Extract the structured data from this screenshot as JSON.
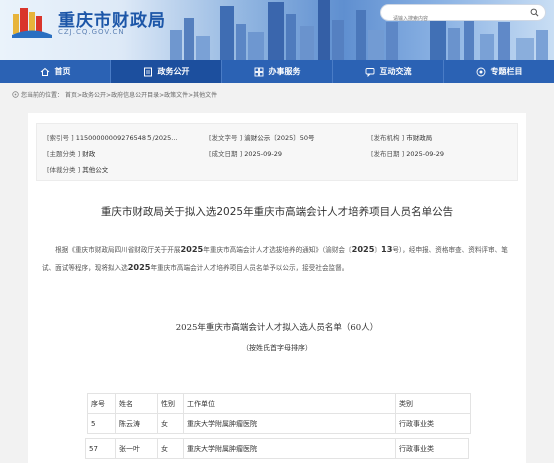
{
  "header": {
    "site_title": "重庆市财政局",
    "site_domain": "CZJ.CQ.GOV.CN",
    "search_placeholder": "请输入搜索内容"
  },
  "nav": {
    "items": [
      {
        "label": "首页",
        "icon": "home-icon"
      },
      {
        "label": "政务公开",
        "icon": "document-icon"
      },
      {
        "label": "办事服务",
        "icon": "service-icon"
      },
      {
        "label": "互动交流",
        "icon": "chat-icon"
      },
      {
        "label": "专题栏目",
        "icon": "topic-icon"
      }
    ],
    "active_index": 1
  },
  "breadcrumb": {
    "prefix": "您当前的位置：",
    "path": "首页>政务公开>政府信息公开目录>政策文件>其他文件"
  },
  "meta": {
    "index_no_label": "[索引号 ]",
    "index_no": "11500000009276548５/2025...",
    "doc_no_label": "[发文字号 ]",
    "doc_no": "渝财公示〔2025〕50号",
    "issuer_label": "[发布机构 ]",
    "issuer": "市财政局",
    "topic_label": "[主题分类 ]",
    "topic": "财政",
    "written_label": "[成文日期 ]",
    "written_date": "2025-09-29",
    "publish_label": "[发布日期 ]",
    "publish_date": "2025-09-29",
    "form_label": "[体裁分类 ]",
    "form": "其他公文"
  },
  "doc_title": "重庆市财政局关于拟入选2025年重庆市高端会计人才培养项目人员名单公告",
  "paragraph": {
    "p1": "根据《重庆市财政局四川省财政厅关于开展",
    "n1": "2025",
    "p2": "年重庆市高端会计人才选拔培养的通知》（渝财会〔",
    "n2": "2025",
    "p3": "〕",
    "n3": "13",
    "p4": "号），经申报、资格审查、资料评审、笔试、面试等程序，现将拟入选",
    "n4": "2025",
    "p5": "年重庆市高端会计人才培养项目人员名单予以公示，接受社会监督。"
  },
  "list": {
    "title": "2025年重庆市高端会计人才拟入选人员名单（60人）",
    "subtitle": "（按姓氏首字母排序）"
  },
  "table": {
    "headers": [
      "序号",
      "姓名",
      "性别",
      "工作单位",
      "类别"
    ],
    "rows": [
      [
        "5",
        "陈云涛",
        "女",
        "重庆大学附属肿瘤医院",
        "行政事业类"
      ]
    ],
    "rows2": [
      [
        "57",
        "张一叶",
        "女",
        "重庆大学附属肿瘤医院",
        "行政事业类"
      ]
    ]
  }
}
